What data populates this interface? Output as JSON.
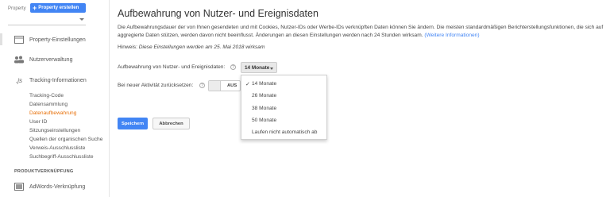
{
  "sidebar": {
    "property_label": "Property",
    "create_button": "Property erstellen",
    "items": [
      {
        "label": "Property-Einstellungen",
        "icon": "property-settings-icon"
      },
      {
        "label": "Nutzerverwaltung",
        "icon": "users-icon"
      },
      {
        "label": "Tracking-Informationen",
        "icon": "js-icon"
      }
    ],
    "sub_items": [
      "Tracking-Code",
      "Datensammlung",
      "Datenaufbewahrung",
      "User ID",
      "Sitzungseinstellungen",
      "Quellen der organischen Suche",
      "Verweis-Ausschlussliste",
      "Suchbegriff-Ausschlussliste"
    ],
    "active_sub_item": "Datenaufbewahrung",
    "section_heading": "PRODUKTVERKNÜPFUNG",
    "adwords_item": "AdWords-Verknüpfung"
  },
  "main": {
    "title": "Aufbewahrung von Nutzer- und Ereignisdaten",
    "description": "Die Aufbewahrungsdauer der von Ihnen gesendeten und mit Cookies, Nutzer-IDs oder Werbe-IDs verknüpften Daten können Sie ändern. Die meisten standardmäßigen Berichterstellungsfunktionen, die sich auf aggregierte Daten stützen, werden davon nicht beeinflusst. Änderungen an diesen Einstellungen werden nach 24 Stunden wirksam.",
    "more_info_link": "(Weitere Informationen)",
    "hint_prefix": "Hinweis:",
    "hint_text": "Diese Einstellungen werden am 25. Mai 2018 wirksam",
    "retention_label": "Aufbewahrung von Nutzer- und Ereignisdaten:",
    "retention_value": "14 Monate",
    "reset_label": "Bei neuer Aktivität zurücksetzen:",
    "reset_toggle": "AUS",
    "dropdown_options": [
      "14 Monate",
      "26 Monate",
      "38 Monate",
      "50 Monate",
      "Laufen nicht automatisch ab"
    ],
    "selected_option": "14 Monate",
    "save_button": "Speichern",
    "cancel_button": "Abbrechen"
  },
  "colors": {
    "accent_blue": "#4285f4",
    "active_orange": "#e8710a"
  }
}
